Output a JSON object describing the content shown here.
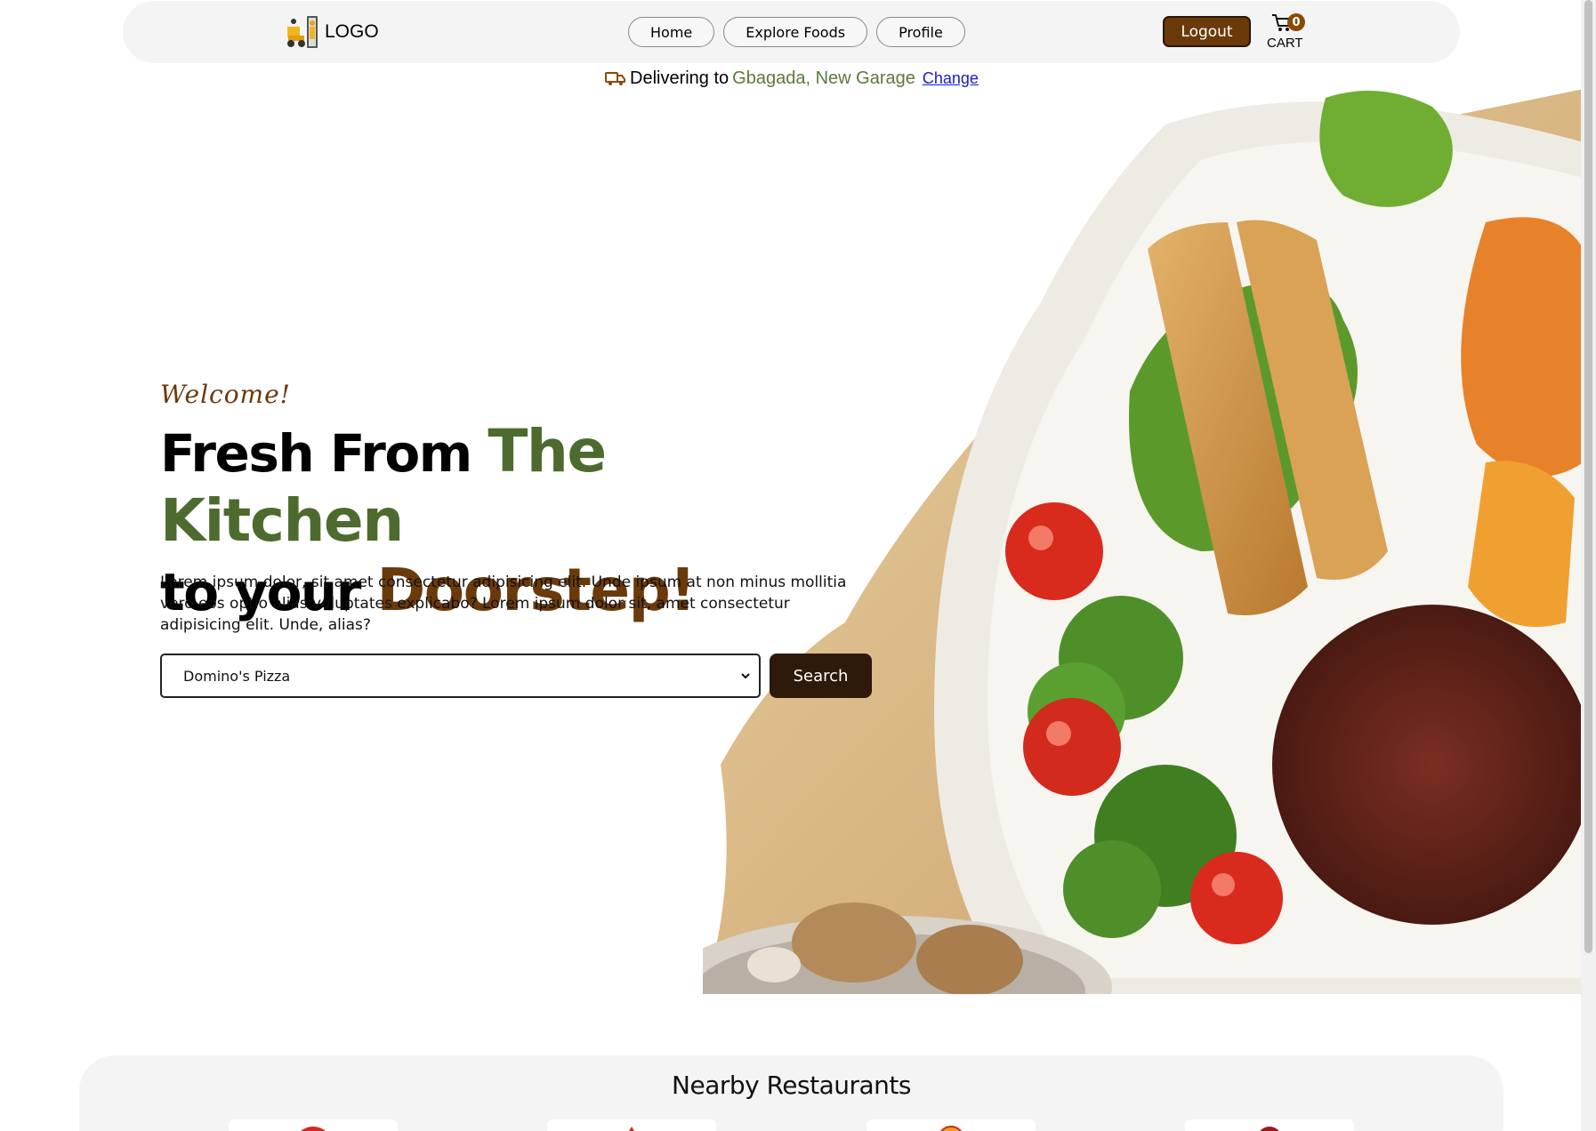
{
  "header": {
    "logo_text": "LOGO",
    "nav": [
      {
        "label": "Home"
      },
      {
        "label": "Explore Foods"
      },
      {
        "label": "Profile"
      }
    ],
    "logout_label": "Logout",
    "cart": {
      "count": "0",
      "label": "CART"
    }
  },
  "delivery": {
    "label": "Delivering to",
    "location": "Gbagada, New Garage",
    "change_label": "Change"
  },
  "hero": {
    "welcome": "Welcome!",
    "headline_part1": "Fresh From ",
    "headline_highlight1": "The Kitchen",
    "headline_part2": "to your ",
    "headline_highlight2": "Doorstep!",
    "description": "Lorem ipsum dolor, sit amet consectetur adipisicing elit. Unde ipsum at non minus mollitia vero eos optio alias voluptates explicabo? Lorem ipsum dolor sit, amet consectetur adipisicing elit. Unde, alias?",
    "select_value": "Domino's Pizza",
    "search_label": "Search"
  },
  "nearby": {
    "title": "Nearby Restaurants"
  },
  "colors": {
    "accent_green": "#4d6b2e",
    "accent_brown": "#6b3a0a",
    "dark_button": "#2e1a0a",
    "panel_bg": "#f4f4f4"
  }
}
